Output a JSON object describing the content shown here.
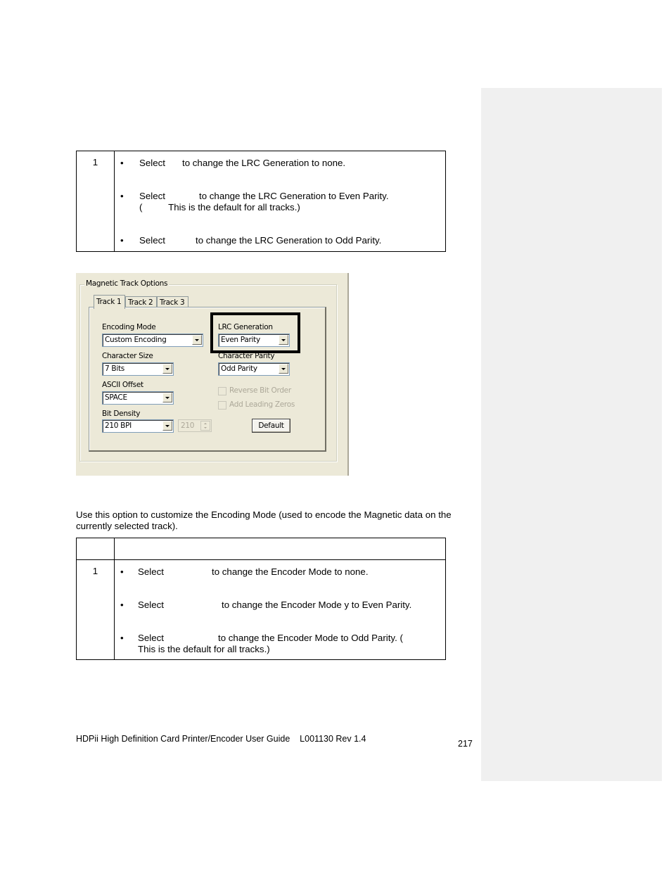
{
  "lrc_table": {
    "row_number": "1",
    "bullets": [
      {
        "bullet": "•",
        "select": "Select",
        "text": "to change the LRC Generation to none.",
        "continuation": ""
      },
      {
        "bullet": "•",
        "select": "Select",
        "text": "to change the LRC Generation to Even Parity.",
        "continuation": "(          This is the default for all tracks.)"
      },
      {
        "bullet": "•",
        "select": "Select",
        "text": "to change the LRC Generation to Odd Parity.",
        "continuation": ""
      }
    ]
  },
  "dialog": {
    "group_title": "Magnetic Track Options",
    "tabs": [
      {
        "label": "Track 1",
        "active": true
      },
      {
        "label": "Track 2",
        "active": false
      },
      {
        "label": "Track 3",
        "active": false
      }
    ],
    "fields": {
      "encoding_mode": {
        "label": "Encoding Mode",
        "value": "Custom Encoding"
      },
      "character_size": {
        "label": "Character Size",
        "value": "7 Bits"
      },
      "ascii_offset": {
        "label": "ASCII Offset",
        "value": "SPACE"
      },
      "bit_density": {
        "label": "Bit Density",
        "value": "210 BPI",
        "spin_value": "210"
      },
      "lrc_generation": {
        "label": "LRC Generation",
        "value": "Even Parity"
      },
      "character_parity": {
        "label": "Character Parity",
        "value": "Odd Parity"
      }
    },
    "checkboxes": [
      {
        "label": "Reverse Bit Order",
        "checked": false,
        "enabled": false
      },
      {
        "label": "Add Leading Zeros",
        "checked": false,
        "enabled": false
      }
    ],
    "default_button": "Default"
  },
  "paragraph": "Use this option to customize the Encoding Mode (used to encode the Magnetic data on the currently selected track).",
  "encoding_table": {
    "header": [
      "",
      ""
    ],
    "row_number": "1",
    "bullets": [
      {
        "bullet": "•",
        "select": "Select",
        "text": "to change the Encoder Mode to none.",
        "continuation": ""
      },
      {
        "bullet": "•",
        "select": "Select",
        "text": "to change the Encoder Mode y to Even Parity.",
        "continuation": ""
      },
      {
        "bullet": "•",
        "select": "Select",
        "text": "to change the Encoder Mode to Odd Parity. (",
        "continuation": "This is the default for all tracks.)"
      }
    ]
  },
  "footer": {
    "title": "HDPii High Definition Card Printer/Encoder User Guide    L001130 Rev 1.4",
    "page_number": "217"
  }
}
